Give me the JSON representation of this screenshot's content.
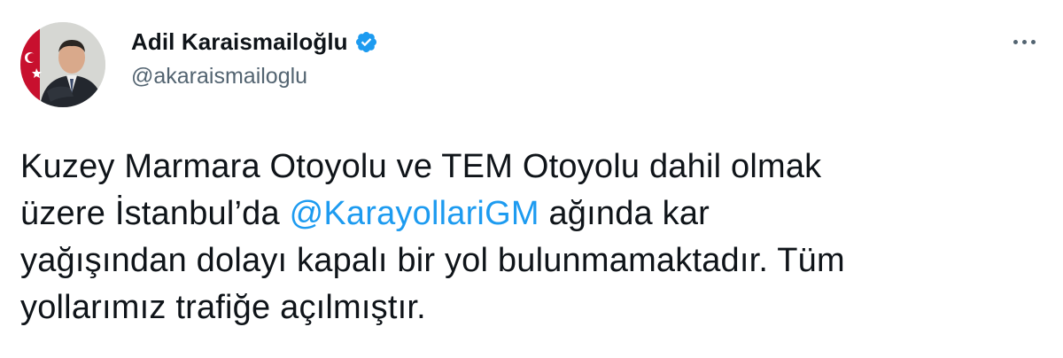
{
  "author": {
    "display_name": "Adil Karaismailoğlu",
    "handle": "@akaraismailoglu",
    "verified": true,
    "verified_color": "#1d9bf0"
  },
  "menu": {
    "icon": "more-horizontal-icon"
  },
  "tweet": {
    "line1": "Kuzey Marmara Otoyolu ve TEM Otoyolu dahil olmak",
    "line2_before": "üzere İstanbul’da ",
    "mention": "@KarayollariGM",
    "line2_after": " ağında kar",
    "line3": "yağışından dolayı kapalı bir yol bulunmamaktadır. Tüm",
    "line4": "yollarımız trafiğe açılmıştır.",
    "mention_color": "#1d9bf0"
  }
}
